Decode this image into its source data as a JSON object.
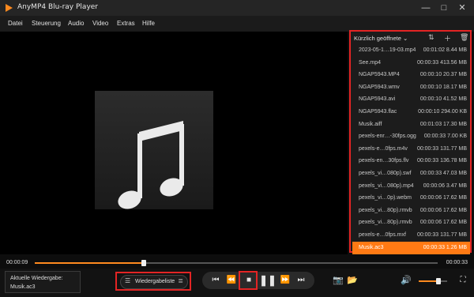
{
  "app": {
    "title": "AnyMP4 Blu-ray Player"
  },
  "window_controls": [
    "—",
    "□",
    "✕"
  ],
  "menu": [
    "Datei",
    "Steuerung",
    "Audio",
    "Video",
    "Extras",
    "Hilfe"
  ],
  "playlist": {
    "header_label": "Kürzlich geöffnete",
    "items": [
      {
        "name": "2023-05-1…19-03.mp4",
        "meta": "00:01:02 8.44 MB"
      },
      {
        "name": "See.mp4",
        "meta": "00:00:33 413.56 MB"
      },
      {
        "name": "NGAP5943.MP4",
        "meta": "00:00:10 20.37 MB"
      },
      {
        "name": "NGAP5943.wmv",
        "meta": "00:00:10 18.17 MB"
      },
      {
        "name": "NGAP5943.avi",
        "meta": "00:00:10 41.52 MB"
      },
      {
        "name": "NGAP5943.flac",
        "meta": "00:00:10 294.00 KB"
      },
      {
        "name": "Musik.aiff",
        "meta": "00:01:03 17.30 MB"
      },
      {
        "name": "pexels-enr…-30fps.ogg",
        "meta": "00:00:33 7.00 KB"
      },
      {
        "name": "pexels-e…0fps.m4v",
        "meta": "00:00:33 131.77 MB"
      },
      {
        "name": "pexels-en…30fps.flv",
        "meta": "00:00:33 136.78 MB"
      },
      {
        "name": "pexels_vi…080p).swf",
        "meta": "00:00:33 47.03 MB"
      },
      {
        "name": "pexels_vi…080p).mp4",
        "meta": "00:00:06 3.47 MB"
      },
      {
        "name": "pexels_vi…0p).webm",
        "meta": "00:00:06 17.62 MB"
      },
      {
        "name": "pexels_vi…80p).rmvb",
        "meta": "00:00:06 17.62 MB"
      },
      {
        "name": "pexels_vi…80p).rmvb",
        "meta": "00:00:06 17.62 MB"
      },
      {
        "name": "pexels-e…0fps.mxf",
        "meta": "00:00:33 131.77 MB"
      },
      {
        "name": "Musik.ac3",
        "meta": "00:00:33 1.26 MB"
      }
    ]
  },
  "player": {
    "current_time": "00:00:09",
    "total_time": "00:00:33",
    "progress": 0.27,
    "now_playing_label": "Aktuelle Wiedergabe:",
    "now_playing_file": "Musik.ac3",
    "playlist_button": "Wiedergabeliste",
    "volume": 0.7
  },
  "colors": {
    "accent": "#ff8a1f",
    "highlight": "#e32424",
    "active_row": "#ff7a14"
  }
}
